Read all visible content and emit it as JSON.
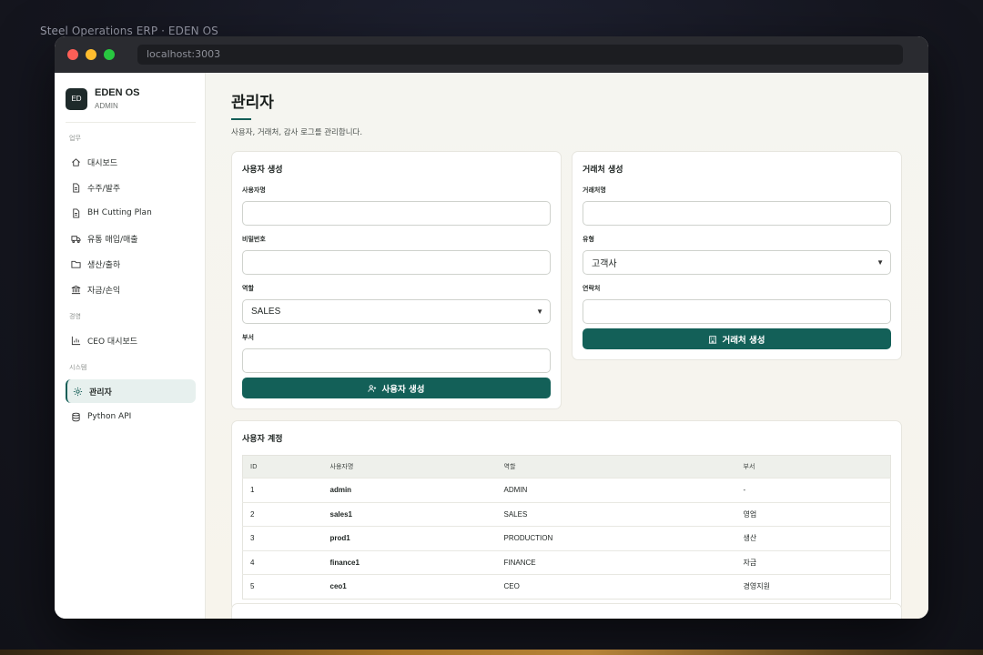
{
  "caption": "Steel Operations ERP · EDEN OS",
  "browser": {
    "url": "localhost:3003"
  },
  "brand": {
    "logo": "ED",
    "name": "EDEN OS",
    "role": "ADMIN"
  },
  "sidebar": {
    "sections": [
      {
        "label": "업무",
        "items": [
          {
            "label": "대시보드",
            "icon": "home-icon"
          },
          {
            "label": "수주/발주",
            "icon": "document-icon"
          },
          {
            "label": "BH Cutting Plan",
            "icon": "document-icon"
          },
          {
            "label": "유통 매입/매출",
            "icon": "truck-icon"
          },
          {
            "label": "생산/출하",
            "icon": "folder-icon"
          },
          {
            "label": "자금/손익",
            "icon": "bank-icon"
          }
        ]
      },
      {
        "label": "경영",
        "items": [
          {
            "label": "CEO 대시보드",
            "icon": "chart-icon"
          }
        ]
      },
      {
        "label": "시스템",
        "items": [
          {
            "label": "관리자",
            "icon": "gear-icon",
            "active": true
          },
          {
            "label": "Python API",
            "icon": "database-icon"
          }
        ]
      }
    ]
  },
  "page": {
    "title": "관리자",
    "subtitle": "사용자, 거래처, 감사 로그를 관리합니다."
  },
  "user_form": {
    "title": "사용자 생성",
    "username_label": "사용자명",
    "username_value": "",
    "password_label": "비밀번호",
    "password_value": "",
    "role_label": "역할",
    "role_value": "SALES",
    "dept_label": "부서",
    "dept_value": "",
    "submit_label": "사용자 생성"
  },
  "partner_form": {
    "title": "거래처 생성",
    "name_label": "거래처명",
    "name_value": "",
    "type_label": "유형",
    "type_value": "고객사",
    "contact_label": "연락처",
    "contact_value": "",
    "submit_label": "거래처 생성"
  },
  "accounts": {
    "title": "사용자 계정",
    "columns": [
      "ID",
      "사용자명",
      "역할",
      "부서"
    ],
    "rows": [
      [
        "1",
        "admin",
        "ADMIN",
        "-"
      ],
      [
        "2",
        "sales1",
        "SALES",
        "영업"
      ],
      [
        "3",
        "prod1",
        "PRODUCTION",
        "생산"
      ],
      [
        "4",
        "finance1",
        "FINANCE",
        "자금"
      ],
      [
        "5",
        "ceo1",
        "CEO",
        "경영지원"
      ]
    ]
  },
  "colors": {
    "accent": "#136058",
    "active_bg": "#e7f0ee"
  }
}
